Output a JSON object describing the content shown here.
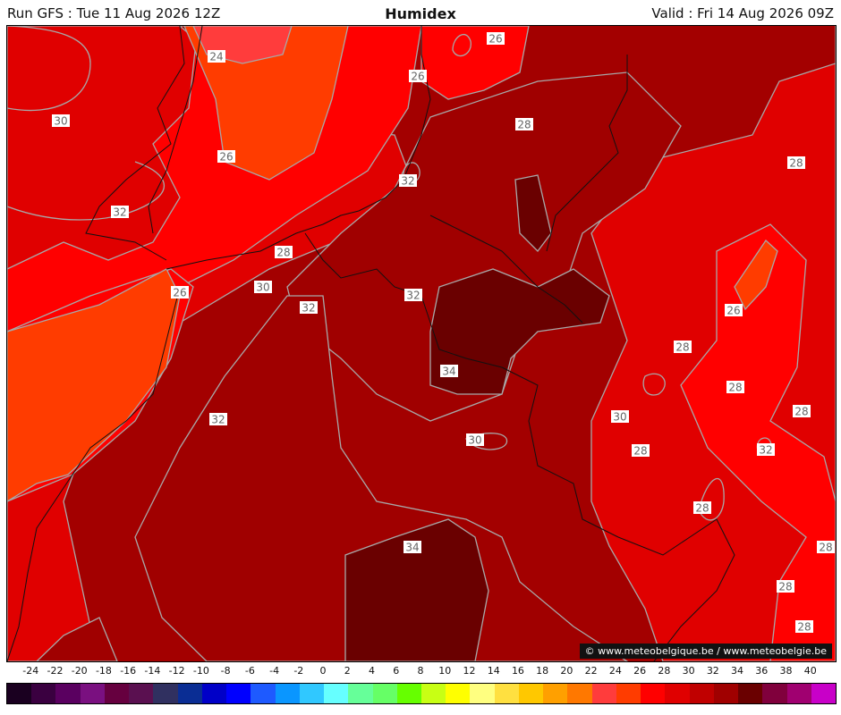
{
  "header": {
    "run": "Run GFS : Tue 11 Aug 2026 12Z",
    "title": "Humidex",
    "valid": "Valid : Fri 14 Aug 2026 09Z"
  },
  "credit": "© www.meteobelgique.be / www.meteobelgie.be",
  "contour_labels": [
    "24",
    "26",
    "26",
    "30",
    "26",
    "28",
    "32",
    "32",
    "28",
    "30",
    "26",
    "32",
    "32",
    "34",
    "32",
    "26",
    "28",
    "28",
    "30",
    "28",
    "28",
    "30",
    "28",
    "28",
    "32",
    "30",
    "34",
    "28",
    "28",
    "28"
  ],
  "legend": {
    "ticks": [
      "-24",
      "-22",
      "-20",
      "-18",
      "-16",
      "-14",
      "-12",
      "-10",
      "-8",
      "-6",
      "-4",
      "-2",
      "0",
      "2",
      "4",
      "6",
      "8",
      "10",
      "12",
      "14",
      "16",
      "18",
      "20",
      "22",
      "24",
      "26",
      "28",
      "30",
      "32",
      "34",
      "36",
      "38",
      "40"
    ],
    "colors": [
      "#1a0020",
      "#3a0040",
      "#5a0060",
      "#7a1080",
      "#66003f",
      "#5a1050",
      "#303060",
      "#0a2d94",
      "#0000c8",
      "#0000ff",
      "#1e5aff",
      "#0a96ff",
      "#30c8ff",
      "#66ffff",
      "#66ff99",
      "#66ff66",
      "#66ff00",
      "#c8ff14",
      "#ffff00",
      "#ffff80",
      "#ffe040",
      "#ffc800",
      "#ffa000",
      "#ff7800",
      "#ff3c3c",
      "#ff3c00",
      "#ff0000",
      "#e00000",
      "#c00000",
      "#a00000",
      "#6a0000",
      "#80003c",
      "#a00070",
      "#c800c8"
    ]
  }
}
